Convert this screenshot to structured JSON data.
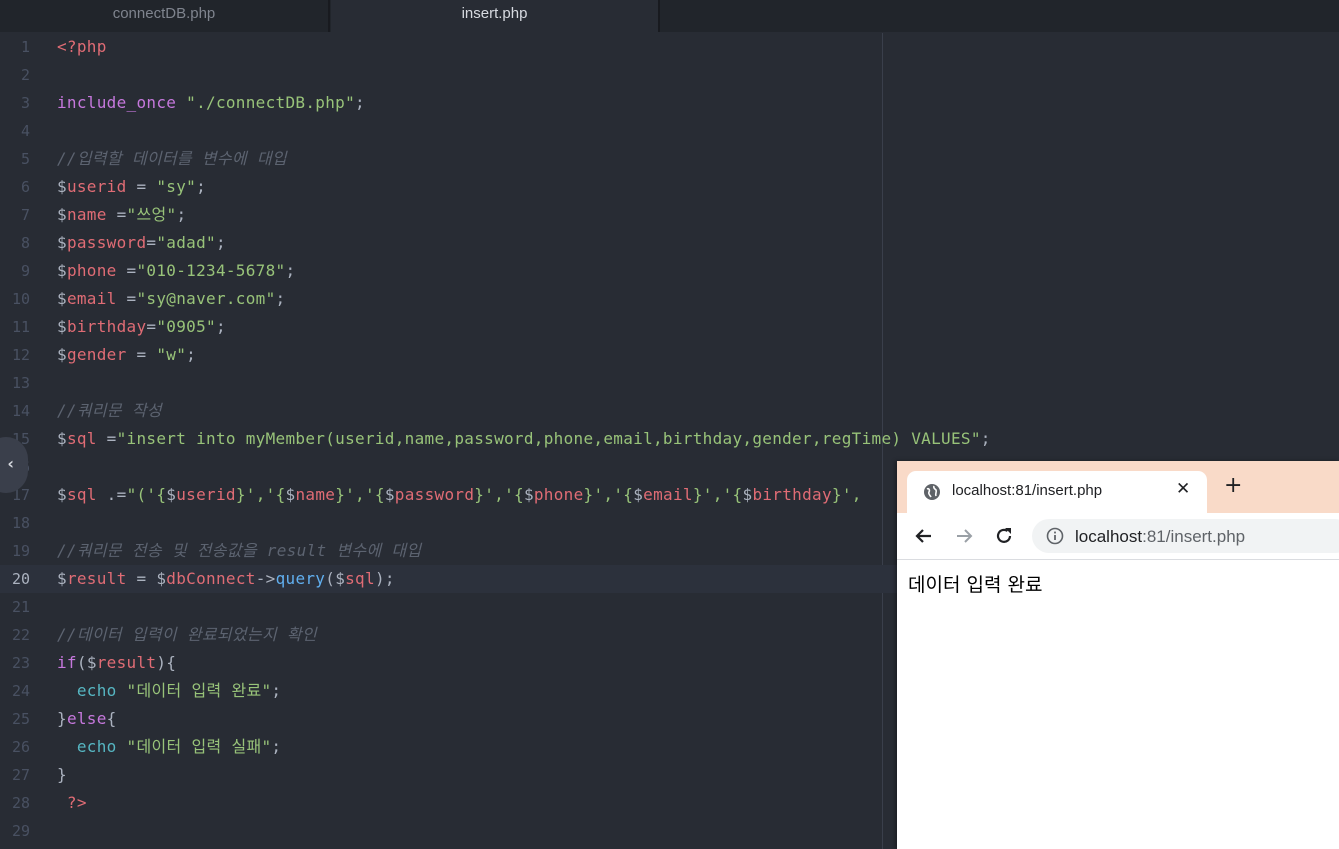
{
  "editor": {
    "tabs": [
      {
        "label": "connectDB.php",
        "active": false
      },
      {
        "label": "insert.php",
        "active": true
      }
    ],
    "active_line": 20
  },
  "code_lines": [
    [
      [
        "<?php",
        "tag"
      ]
    ],
    [],
    [
      [
        "include_once",
        "kw"
      ],
      [
        " ",
        "pun"
      ],
      [
        "\"./connectDB.php\"",
        "str"
      ],
      [
        ";",
        "pun"
      ]
    ],
    [],
    [
      [
        "//입력할 데이터를 변수에 대입",
        "com"
      ]
    ],
    [
      [
        "$",
        "dol"
      ],
      [
        "userid",
        "var"
      ],
      [
        " = ",
        "pun"
      ],
      [
        "\"sy\"",
        "str"
      ],
      [
        ";",
        "pun"
      ]
    ],
    [
      [
        "$",
        "dol"
      ],
      [
        "name",
        "var"
      ],
      [
        " =",
        "pun"
      ],
      [
        "\"쓰엉\"",
        "str"
      ],
      [
        ";",
        "pun"
      ]
    ],
    [
      [
        "$",
        "dol"
      ],
      [
        "password",
        "var"
      ],
      [
        "=",
        "pun"
      ],
      [
        "\"adad\"",
        "str"
      ],
      [
        ";",
        "pun"
      ]
    ],
    [
      [
        "$",
        "dol"
      ],
      [
        "phone",
        "var"
      ],
      [
        " =",
        "pun"
      ],
      [
        "\"010-1234-5678\"",
        "str"
      ],
      [
        ";",
        "pun"
      ]
    ],
    [
      [
        "$",
        "dol"
      ],
      [
        "email",
        "var"
      ],
      [
        " =",
        "pun"
      ],
      [
        "\"sy@naver.com\"",
        "str"
      ],
      [
        ";",
        "pun"
      ]
    ],
    [
      [
        "$",
        "dol"
      ],
      [
        "birthday",
        "var"
      ],
      [
        "=",
        "pun"
      ],
      [
        "\"0905\"",
        "str"
      ],
      [
        ";",
        "pun"
      ]
    ],
    [
      [
        "$",
        "dol"
      ],
      [
        "gender",
        "var"
      ],
      [
        " = ",
        "pun"
      ],
      [
        "\"w\"",
        "str"
      ],
      [
        ";",
        "pun"
      ]
    ],
    [],
    [
      [
        "//쿼리문 작성",
        "com"
      ]
    ],
    [
      [
        "$",
        "dol"
      ],
      [
        "sql",
        "var"
      ],
      [
        " =",
        "pun"
      ],
      [
        "\"insert into myMember(userid,name,password,phone,email,birthday,gender,regTime) VALUES\"",
        "str"
      ],
      [
        ";",
        "pun"
      ]
    ],
    [],
    [
      [
        "$",
        "dol"
      ],
      [
        "sql",
        "var"
      ],
      [
        " .=",
        "pun"
      ],
      [
        "\"('{",
        "str"
      ],
      [
        "$",
        "dol"
      ],
      [
        "userid",
        "var"
      ],
      [
        "}','{",
        "str"
      ],
      [
        "$",
        "dol"
      ],
      [
        "name",
        "var"
      ],
      [
        "}','{",
        "str"
      ],
      [
        "$",
        "dol"
      ],
      [
        "password",
        "var"
      ],
      [
        "}','{",
        "str"
      ],
      [
        "$",
        "dol"
      ],
      [
        "phone",
        "var"
      ],
      [
        "}','{",
        "str"
      ],
      [
        "$",
        "dol"
      ],
      [
        "email",
        "var"
      ],
      [
        "}','{",
        "str"
      ],
      [
        "$",
        "dol"
      ],
      [
        "birthday",
        "var"
      ],
      [
        "}',",
        "str"
      ]
    ],
    [],
    [
      [
        "//쿼리문 전송 및 전송값을 result 변수에 대입",
        "com"
      ]
    ],
    [
      [
        "$",
        "dol"
      ],
      [
        "result",
        "var"
      ],
      [
        " = ",
        "pun"
      ],
      [
        "$",
        "dol"
      ],
      [
        "dbConnect",
        "var"
      ],
      [
        "->",
        "pun"
      ],
      [
        "query",
        "fn"
      ],
      [
        "(",
        "pun"
      ],
      [
        "$",
        "dol"
      ],
      [
        "sql",
        "var"
      ],
      [
        ");",
        "pun"
      ]
    ],
    [],
    [
      [
        "//데이터 입력이 완료되었는지 확인",
        "com"
      ]
    ],
    [
      [
        "if",
        "kw"
      ],
      [
        "(",
        "pun"
      ],
      [
        "$",
        "dol"
      ],
      [
        "result",
        "var"
      ],
      [
        "){",
        "pun"
      ]
    ],
    [
      [
        "  ",
        "pun"
      ],
      [
        "echo",
        "echo"
      ],
      [
        " ",
        "pun"
      ],
      [
        "\"데이터 입력 완료\"",
        "str"
      ],
      [
        ";",
        "pun"
      ]
    ],
    [
      [
        "}",
        "pun"
      ],
      [
        "else",
        "kw"
      ],
      [
        "{",
        "pun"
      ]
    ],
    [
      [
        "  ",
        "pun"
      ],
      [
        "echo",
        "echo"
      ],
      [
        " ",
        "pun"
      ],
      [
        "\"데이터 입력 실패\"",
        "str"
      ],
      [
        ";",
        "pun"
      ]
    ],
    [
      [
        "}",
        "pun"
      ]
    ],
    [
      [
        " ?>",
        "tag"
      ]
    ],
    []
  ],
  "browser": {
    "tab_title": "localhost:81/insert.php",
    "close_glyph": "✕",
    "newtab_glyph": "+",
    "url_host": "localhost",
    "url_path": ":81/insert.php",
    "page_text": "데이터 입력 완료",
    "tabstrip_color": "#f9dac8"
  },
  "icons": {
    "side_toggle": "‹",
    "nav": [
      "back-arrow-icon",
      "forward-arrow-icon",
      "reload-icon"
    ]
  }
}
